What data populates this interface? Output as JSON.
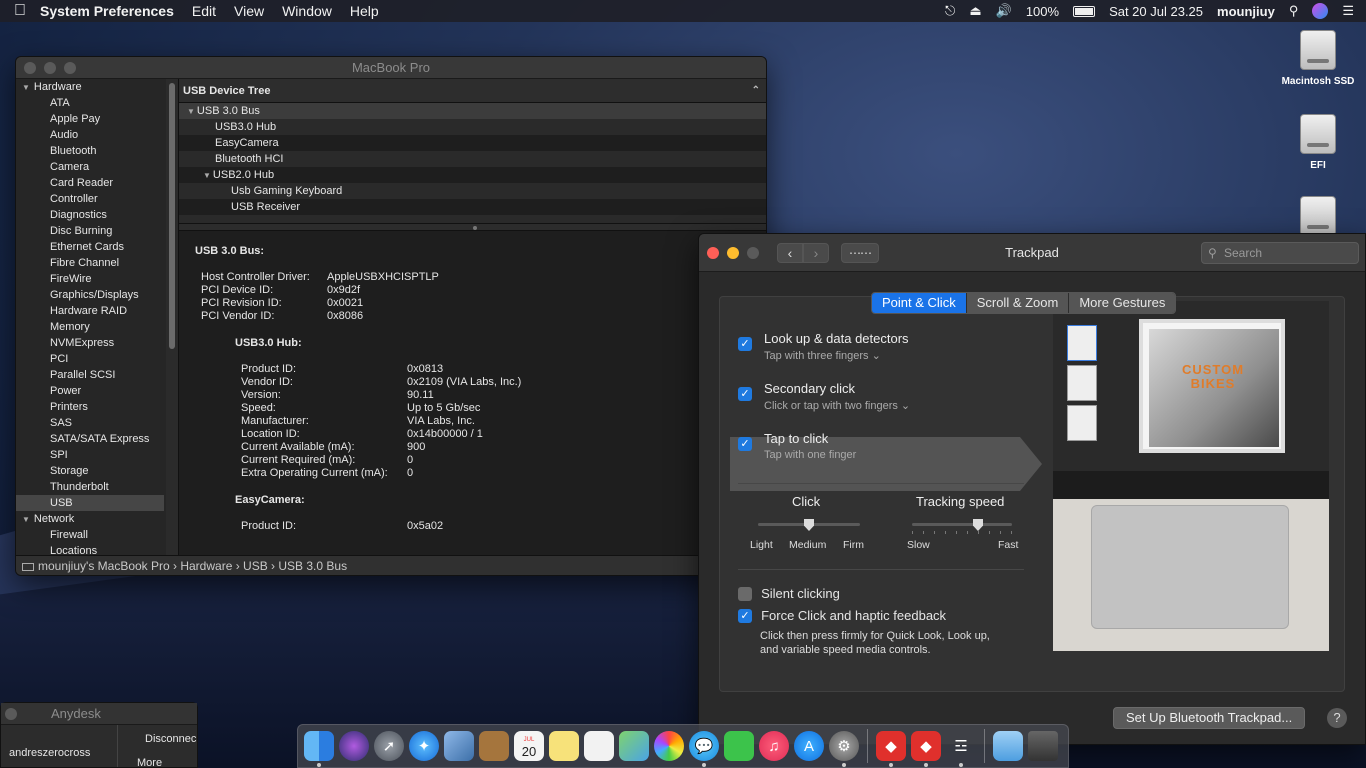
{
  "menubar": {
    "apple_icon": "apple-logo",
    "app_name": "System Preferences",
    "items": [
      "Edit",
      "View",
      "Window",
      "Help"
    ],
    "battery": "100%",
    "datetime": "Sat 20 Jul  23.25",
    "user": "mounjiuy"
  },
  "desktop": {
    "icons": [
      {
        "label": "Macintosh SSD"
      },
      {
        "label": "EFI"
      },
      {
        "label": ""
      }
    ]
  },
  "sysinfo": {
    "title": "MacBook Pro",
    "sidebar": [
      {
        "label": "Hardware",
        "group": true
      },
      {
        "label": "ATA"
      },
      {
        "label": "Apple Pay"
      },
      {
        "label": "Audio"
      },
      {
        "label": "Bluetooth"
      },
      {
        "label": "Camera"
      },
      {
        "label": "Card Reader"
      },
      {
        "label": "Controller"
      },
      {
        "label": "Diagnostics"
      },
      {
        "label": "Disc Burning"
      },
      {
        "label": "Ethernet Cards"
      },
      {
        "label": "Fibre Channel"
      },
      {
        "label": "FireWire"
      },
      {
        "label": "Graphics/Displays"
      },
      {
        "label": "Hardware RAID"
      },
      {
        "label": "Memory"
      },
      {
        "label": "NVMExpress"
      },
      {
        "label": "PCI"
      },
      {
        "label": "Parallel SCSI"
      },
      {
        "label": "Power"
      },
      {
        "label": "Printers"
      },
      {
        "label": "SAS"
      },
      {
        "label": "SATA/SATA Express"
      },
      {
        "label": "SPI"
      },
      {
        "label": "Storage"
      },
      {
        "label": "Thunderbolt"
      },
      {
        "label": "USB",
        "selected": true
      },
      {
        "label": "Network",
        "group": true
      },
      {
        "label": "Firewall"
      },
      {
        "label": "Locations"
      }
    ],
    "tree_header": "USB Device Tree",
    "tree": [
      {
        "label": "USB 3.0 Bus",
        "level": 0,
        "expanded": true,
        "selected": true
      },
      {
        "label": "USB3.0 Hub",
        "level": 1
      },
      {
        "label": "EasyCamera",
        "level": 1
      },
      {
        "label": "Bluetooth HCI",
        "level": 1
      },
      {
        "label": "USB2.0 Hub",
        "level": 1,
        "expanded": true
      },
      {
        "label": "Usb Gaming Keyboard",
        "level": 2
      },
      {
        "label": "USB Receiver",
        "level": 2
      }
    ],
    "detail": {
      "heading": "USB 3.0 Bus:",
      "bus": [
        {
          "k": "Host Controller Driver:",
          "v": "AppleUSBXHCISPTLP"
        },
        {
          "k": "PCI Device ID:",
          "v": "0x9d2f"
        },
        {
          "k": "PCI Revision ID:",
          "v": "0x0021"
        },
        {
          "k": "PCI Vendor ID:",
          "v": "0x8086"
        }
      ],
      "hub_heading": "USB3.0 Hub:",
      "hub": [
        {
          "k": "Product ID:",
          "v": "0x0813"
        },
        {
          "k": "Vendor ID:",
          "v": "0x2109  (VIA Labs, Inc.)"
        },
        {
          "k": "Version:",
          "v": "90.11"
        },
        {
          "k": "Speed:",
          "v": "Up to 5 Gb/sec"
        },
        {
          "k": "Manufacturer:",
          "v": "VIA Labs, Inc."
        },
        {
          "k": "Location ID:",
          "v": "0x14b00000 / 1"
        },
        {
          "k": "Current Available (mA):",
          "v": "900"
        },
        {
          "k": "Current Required (mA):",
          "v": "0"
        },
        {
          "k": "Extra Operating Current (mA):",
          "v": "0"
        }
      ],
      "cam_heading": "EasyCamera:",
      "cam": [
        {
          "k": "Product ID:",
          "v": "0x5a02"
        }
      ]
    },
    "path": "mounjiuy's MacBook Pro  ›  Hardware  ›  USB  ›  USB 3.0 Bus"
  },
  "trackpad": {
    "title": "Trackpad",
    "search_placeholder": "Search",
    "tabs": [
      "Point & Click",
      "Scroll & Zoom",
      "More Gestures"
    ],
    "options": [
      {
        "title": "Look up & data detectors",
        "sub": "Tap with three fingers ⌄",
        "checked": true
      },
      {
        "title": "Secondary click",
        "sub": "Click or tap with two fingers ⌄",
        "checked": true
      },
      {
        "title": "Tap to click",
        "sub": "Tap with one finger",
        "checked": true
      }
    ],
    "click": {
      "title": "Click",
      "labels": [
        "Light",
        "Medium",
        "Firm"
      ],
      "value": "Medium"
    },
    "tracking": {
      "title": "Tracking speed",
      "min": "Slow",
      "max": "Fast",
      "position": 0.7
    },
    "silent": {
      "label": "Silent clicking",
      "checked": false
    },
    "force": {
      "label": "Force Click and haptic feedback",
      "checked": true,
      "desc1": "Click then press firmly for Quick Look, Look up,",
      "desc2": "and variable speed media controls."
    },
    "preview_text": "CUSTOM BIKES",
    "setup_button": "Set Up Bluetooth Trackpad...",
    "help": "?"
  },
  "anydesk": {
    "title": "Anydesk",
    "user": "andreszerocross",
    "disconnect": "Disconnec",
    "more": "More"
  },
  "dock": {
    "date_icon_day": "20",
    "date_icon_month": "JUL"
  },
  "colors": {
    "accent": "#1f7ae0",
    "close": "#ff5f57",
    "minimize": "#febc2e",
    "zoom_disabled": "#5a5a5a"
  }
}
